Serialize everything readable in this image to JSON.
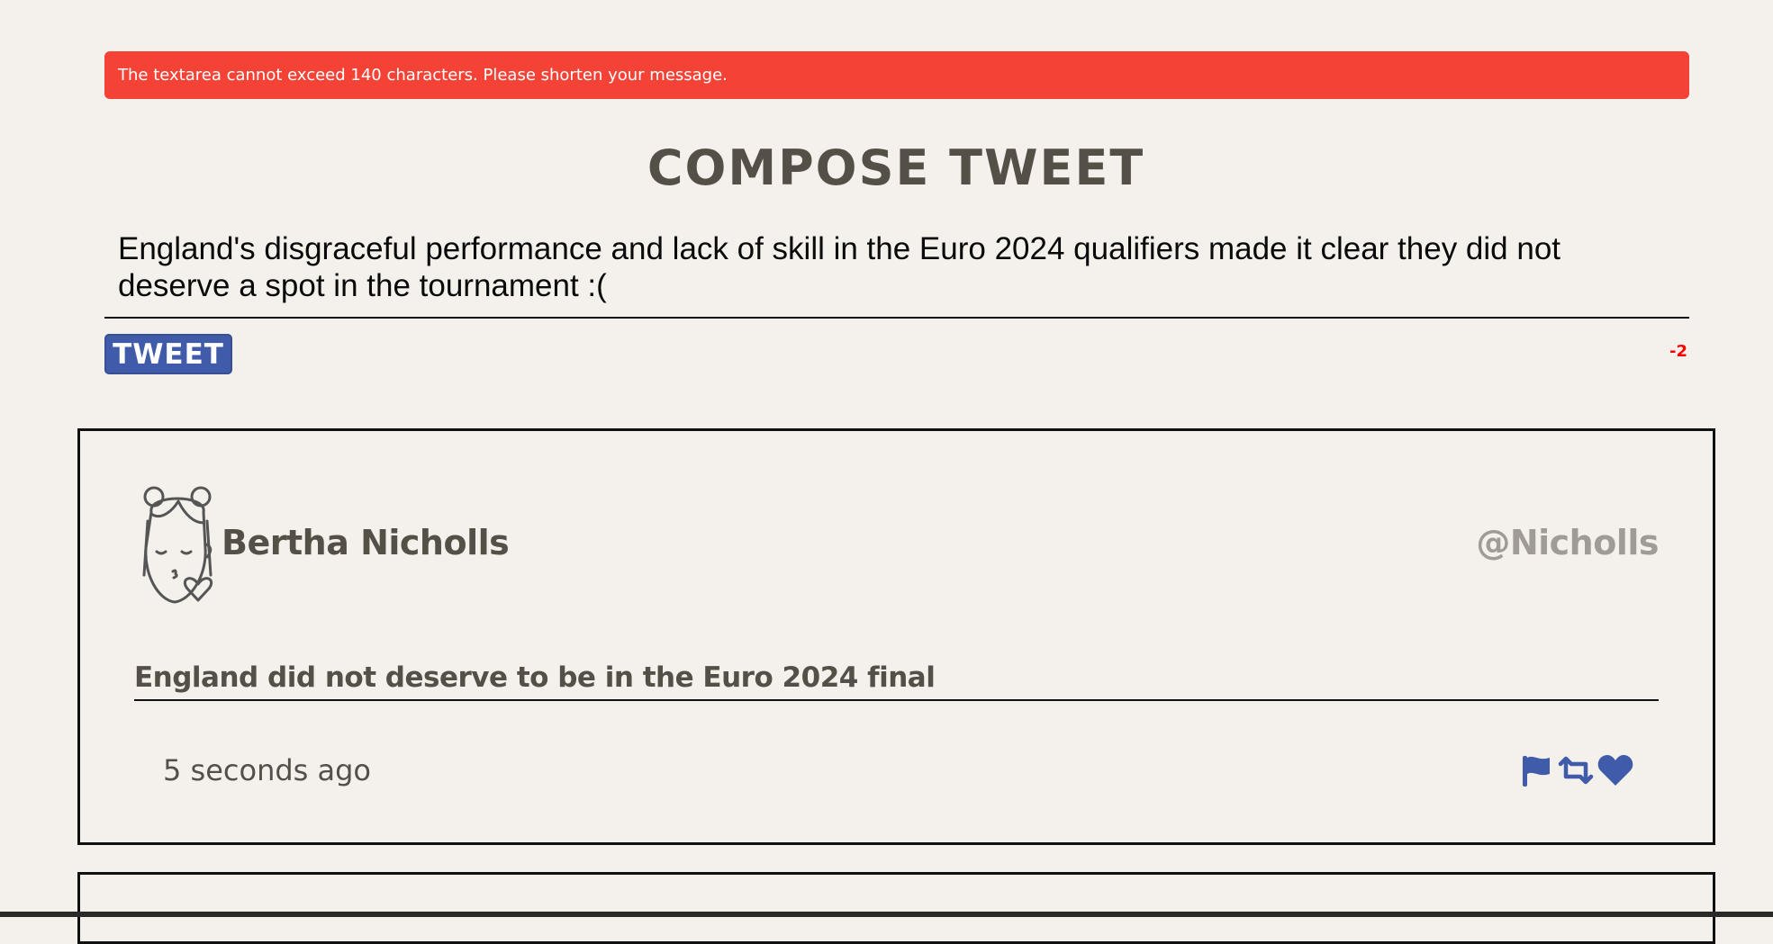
{
  "error_banner": {
    "text": "The textarea cannot exceed 140 characters. Please shorten your message."
  },
  "compose": {
    "title": "COMPOSE TWEET",
    "textarea_value": "England's disgraceful performance and lack of skill in the Euro 2024 qualifiers made it clear they did not deserve a spot in the tournament :(",
    "tweet_button_label": "TWEET",
    "char_counter": "-2"
  },
  "tweets": [
    {
      "author_name": "Bertha Nicholls",
      "handle": "@Nicholls",
      "text": "England did not deserve to be in the Euro 2024 final",
      "timestamp": "5 seconds ago",
      "actions": [
        "flag-icon",
        "retweet-icon",
        "heart-icon"
      ]
    }
  ],
  "colors": {
    "error": "#f44336",
    "accent": "#3f5ba9",
    "counter_negative": "#ff0000",
    "background": "#f4f1ec",
    "text_dark": "#545048",
    "text_muted": "#a09c95"
  }
}
